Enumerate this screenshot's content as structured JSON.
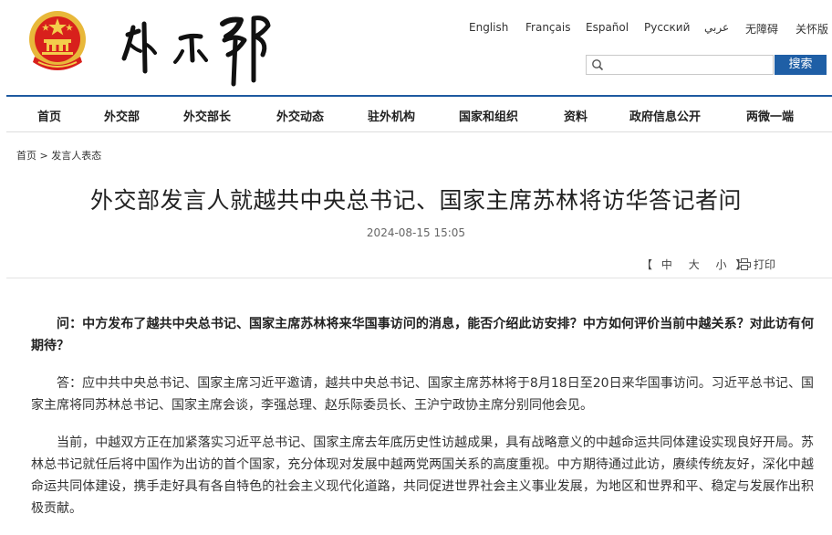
{
  "header": {
    "languages": [
      "English",
      "Français",
      "Español",
      "Русский",
      "عربي",
      "无障碍",
      "关怀版"
    ],
    "search": {
      "placeholder": "",
      "button_label": "搜索"
    }
  },
  "nav": {
    "items": [
      "首页",
      "外交部",
      "外交部长",
      "外交动态",
      "驻外机构",
      "国家和组织",
      "资料",
      "政府信息公开",
      "两微一端"
    ]
  },
  "breadcrumb": {
    "home": "首页",
    "separator": ">",
    "current": "发言人表态"
  },
  "article": {
    "title": "外交部发言人就越共中央总书记、国家主席苏林将访华答记者问",
    "date": "2024-08-15 15:05",
    "font_size": {
      "open": "【",
      "large": "中",
      "medium": "大",
      "small": "小",
      "close": "】"
    },
    "print_label": "打印",
    "paragraphs": [
      "问：中方发布了越共中央总书记、国家主席苏林将来华国事访问的消息，能否介绍此访安排？中方如何评价当前中越关系？对此访有何期待？",
      "答：应中共中央总书记、国家主席习近平邀请，越共中央总书记、国家主席苏林将于8月18日至20日来华国事访问。习近平总书记、国家主席将同苏林总书记、国家主席会谈，李强总理、赵乐际委员长、王沪宁政协主席分别同他会见。",
      "当前，中越双方正在加紧落实习近平总书记、国家主席去年底历史性访越成果，具有战略意义的中越命运共同体建设实现良好开局。苏林总书记就任后将中国作为出访的首个国家，充分体现对发展中越两党两国关系的高度重视。中方期待通过此访，赓续传统友好，深化中越命运共同体建设，携手走好具有各自特色的社会主义现代化道路，共同促进世界社会主义事业发展，为地区和世界和平、稳定与发展作出积极贡献。"
    ]
  },
  "colors": {
    "brand_blue": "#1f5fa6",
    "emblem_red": "#d8201c",
    "emblem_gold": "#e8b83a"
  },
  "icons": {
    "search": "magnifier-icon",
    "print": "printer-icon",
    "emblem": "national-emblem"
  }
}
